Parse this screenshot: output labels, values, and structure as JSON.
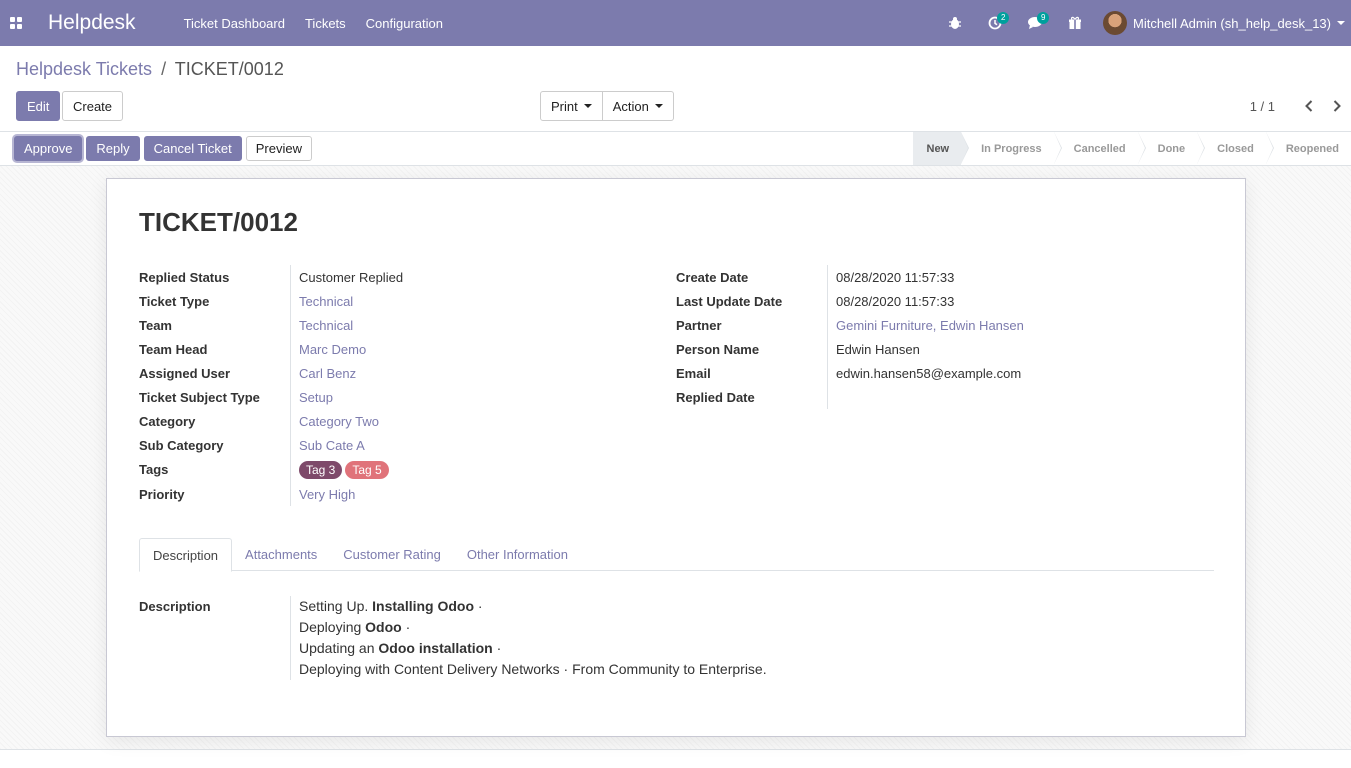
{
  "navbar": {
    "brand": "Helpdesk",
    "menu": [
      "Ticket Dashboard",
      "Tickets",
      "Configuration"
    ],
    "activity_count": "2",
    "messages_count": "9",
    "user": "Mitchell Admin (sh_help_desk_13)"
  },
  "breadcrumb": {
    "parent": "Helpdesk Tickets",
    "separator": "/",
    "current": "TICKET/0012"
  },
  "toolbar": {
    "edit": "Edit",
    "create": "Create",
    "print": "Print",
    "action": "Action",
    "pager": "1 / 1"
  },
  "status_buttons": {
    "approve": "Approve",
    "reply": "Reply",
    "cancel": "Cancel Ticket",
    "preview": "Preview"
  },
  "stages": [
    "New",
    "In Progress",
    "Cancelled",
    "Done",
    "Closed",
    "Reopened"
  ],
  "active_stage": "New",
  "ticket": {
    "title": "TICKET/0012",
    "left": [
      {
        "label": "Replied Status",
        "value": "Customer Replied"
      },
      {
        "label": "Ticket Type",
        "value": "Technical"
      },
      {
        "label": "Team",
        "value": "Technical"
      },
      {
        "label": "Team Head",
        "value": "Marc Demo"
      },
      {
        "label": "Assigned User",
        "value": "Carl Benz"
      },
      {
        "label": "Ticket Subject Type",
        "value": "Setup"
      },
      {
        "label": "Category",
        "value": "Category Two"
      },
      {
        "label": "Sub Category",
        "value": "Sub Cate A"
      },
      {
        "label": "Tags",
        "tags": [
          "Tag 3",
          "Tag 5"
        ]
      },
      {
        "label": "Priority",
        "value": "Very High"
      }
    ],
    "right": [
      {
        "label": "Create Date",
        "value": "08/28/2020 11:57:33"
      },
      {
        "label": "Last Update Date",
        "value": "08/28/2020 11:57:33"
      },
      {
        "label": "Partner",
        "value": "Gemini Furniture, Edwin Hansen"
      },
      {
        "label": "Person Name",
        "value": "Edwin Hansen"
      },
      {
        "label": "Email",
        "value": "edwin.hansen58@example.com"
      },
      {
        "label": "Replied Date",
        "value": ""
      }
    ],
    "tag_colors": [
      "#7e4a6a",
      "#e0737a"
    ]
  },
  "tabs": [
    "Description",
    "Attachments",
    "Customer Rating",
    "Other Information"
  ],
  "description": {
    "label": "Description",
    "line1_a": "Setting Up. ",
    "line1_b": "Installing Odoo",
    "line1_c": " ·",
    "line2_a": "Deploying ",
    "line2_b": "Odoo",
    "line2_c": " ·",
    "line3_a": "Updating an ",
    "line3_b": "Odoo installation",
    "line3_c": " ·",
    "line4": "Deploying with Content Delivery Networks · From Community to Enterprise."
  },
  "colors": {
    "brand": "#7c7bad",
    "badge": "#00a09d"
  }
}
